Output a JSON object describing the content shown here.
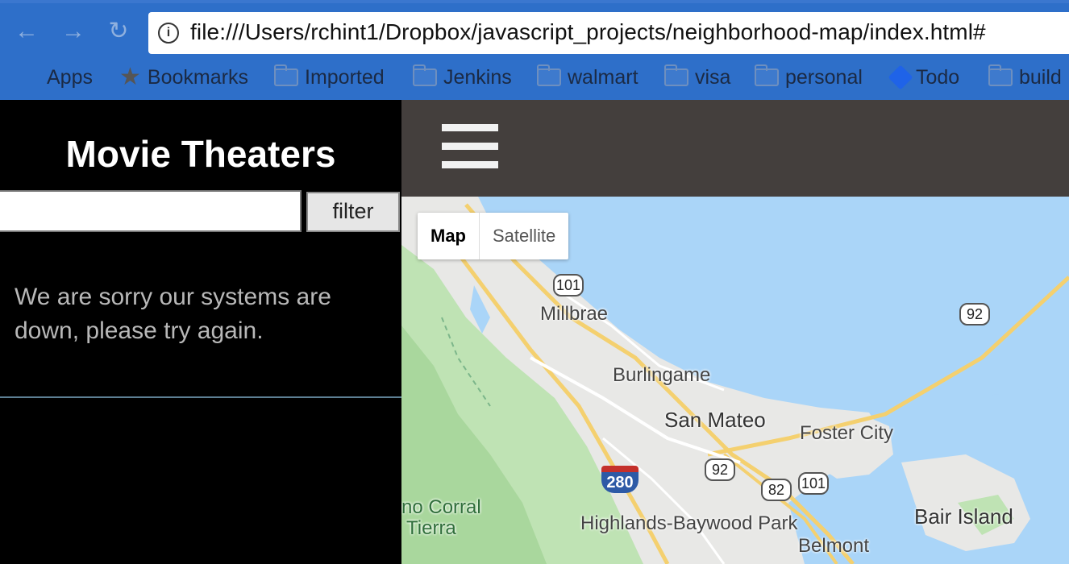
{
  "browser": {
    "url": "file:///Users/rchint1/Dropbox/javascript_projects/neighborhood-map/index.html#",
    "bookmarks": [
      {
        "label": "Apps",
        "icon": "apps-grid-icon"
      },
      {
        "label": "Bookmarks",
        "icon": "star-icon"
      },
      {
        "label": "Imported",
        "icon": "folder-icon"
      },
      {
        "label": "Jenkins",
        "icon": "folder-icon"
      },
      {
        "label": "walmart",
        "icon": "folder-icon"
      },
      {
        "label": "visa",
        "icon": "folder-icon"
      },
      {
        "label": "personal",
        "icon": "folder-icon"
      },
      {
        "label": "Todo",
        "icon": "todo-diamond-icon"
      },
      {
        "label": "build",
        "icon": "folder-icon"
      }
    ]
  },
  "sidebar": {
    "title": "Movie Theaters",
    "filter_value": "",
    "filter_button": "filter",
    "error_message": "We are sorry our systems are down, please try again."
  },
  "map": {
    "map_type_options": [
      "Map",
      "Satellite"
    ],
    "selected_map_type": "Map",
    "places": [
      "Millbrae",
      "Burlingame",
      "San Mateo",
      "Foster City",
      "Bair Island",
      "Highlands-Baywood Park",
      "Belmont",
      "no Corral",
      "Tierra"
    ],
    "route_shields": [
      "101",
      "92",
      "92",
      "82",
      "101",
      "280"
    ]
  }
}
